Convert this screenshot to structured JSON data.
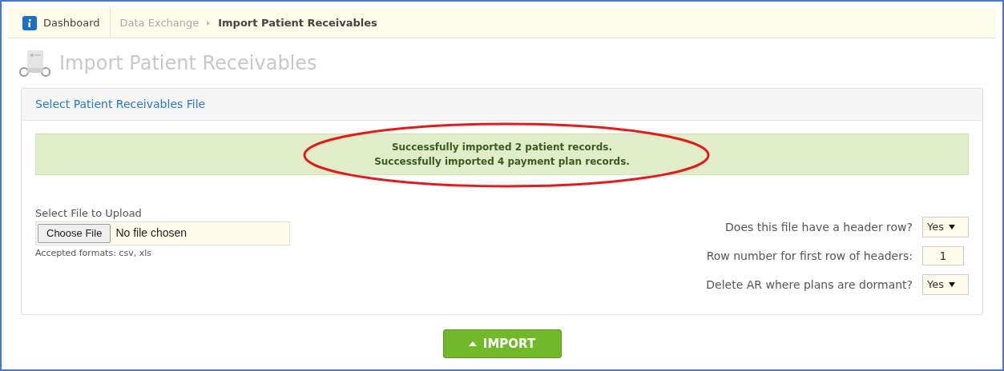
{
  "breadcrumb": [
    {
      "label": "Dashboard",
      "kind": "home"
    },
    {
      "label": "Data Exchange",
      "kind": "link"
    },
    {
      "label": "Import Patient Receivables",
      "kind": "current"
    }
  ],
  "page_title": "Import Patient Receivables",
  "panel": {
    "title": "Select Patient Receivables File",
    "messages": [
      "Successfully imported 2 patient records.",
      "Successfully imported 4 payment plan records."
    ],
    "highlighted": true,
    "upload": {
      "label": "Select File to Upload",
      "button": "Choose File",
      "value": "No file chosen",
      "hint": "Accepted formats: csv, xls"
    },
    "options": [
      {
        "kind": "select",
        "label": "Does this file have a header row?",
        "value": "Yes"
      },
      {
        "kind": "input",
        "label": "Row number for first row of headers:",
        "value": "1"
      },
      {
        "kind": "select",
        "label": "Delete AR where plans are dormant?",
        "value": "Yes"
      }
    ]
  },
  "import_button": "IMPORT"
}
